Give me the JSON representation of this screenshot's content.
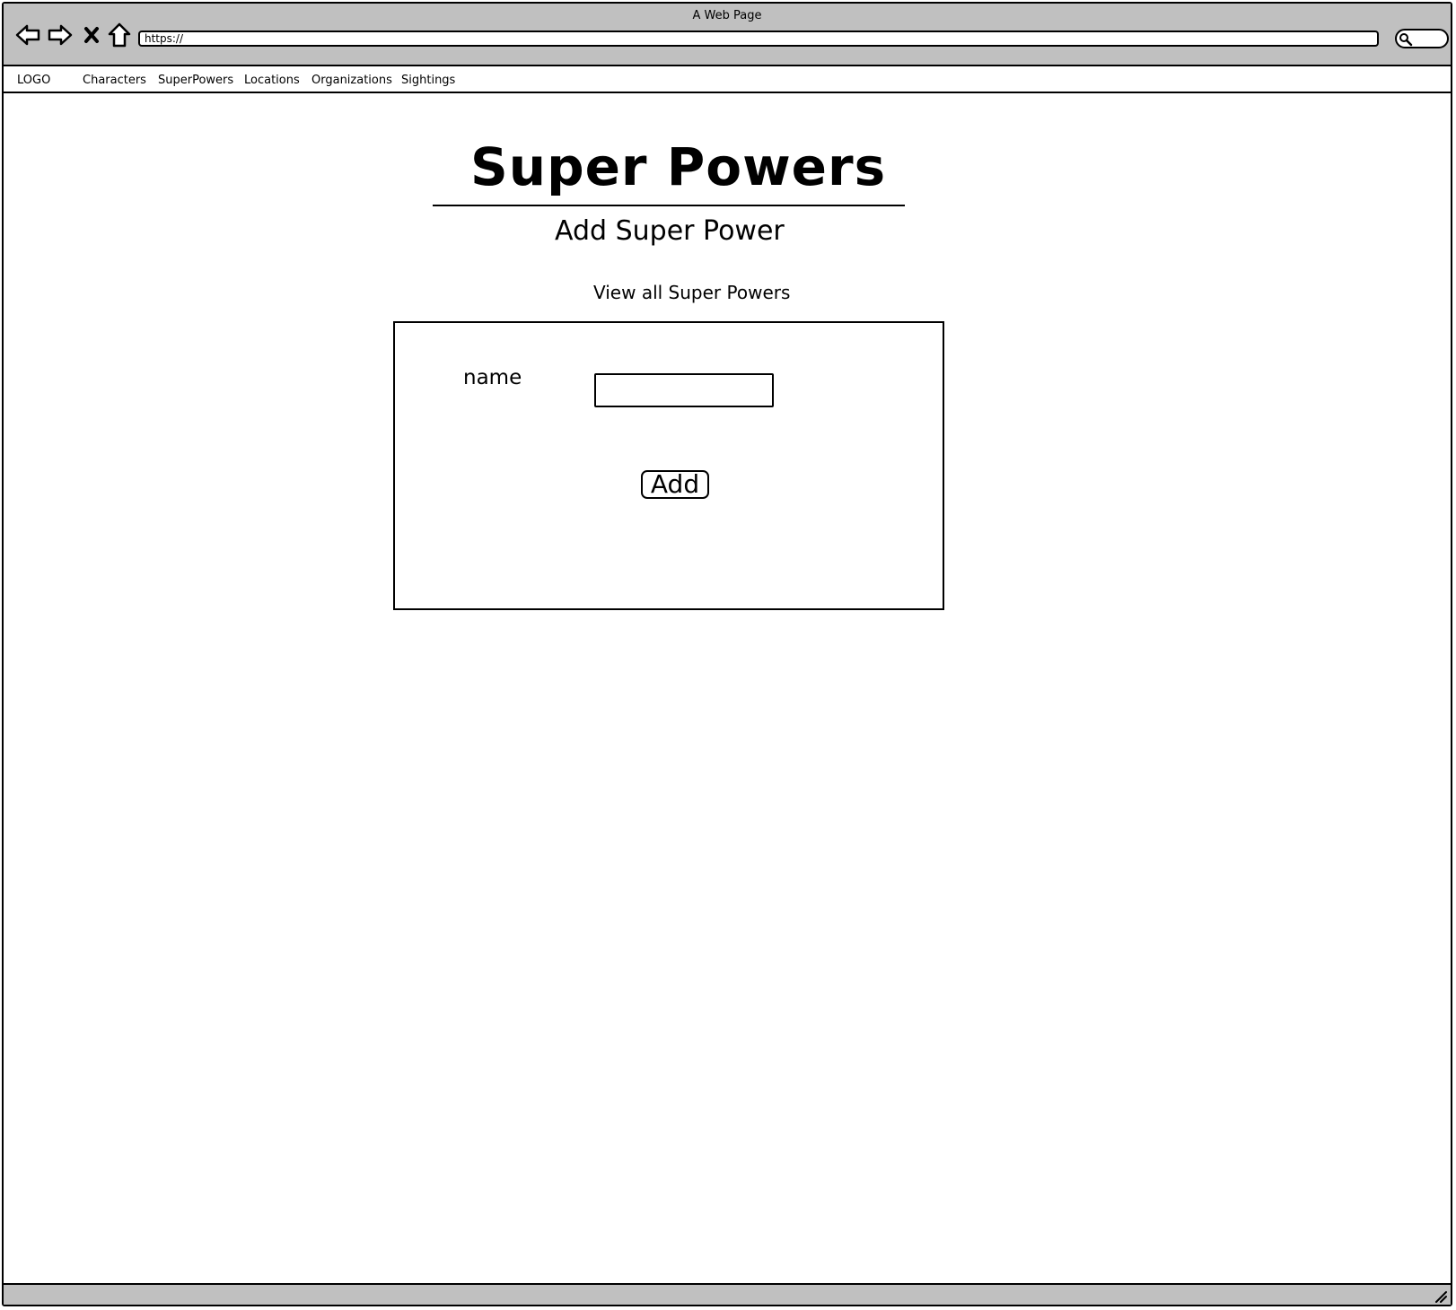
{
  "window": {
    "title": "A Web Page"
  },
  "toolbar": {
    "url": "https://",
    "back_icon": "back-arrow-icon",
    "forward_icon": "forward-arrow-icon",
    "stop_icon": "close-icon",
    "home_icon": "home-icon",
    "search_icon": "search-icon"
  },
  "nav": {
    "logo": "LOGO",
    "items": [
      {
        "label": "Characters"
      },
      {
        "label": "SuperPowers"
      },
      {
        "label": "Locations"
      },
      {
        "label": "Organizations"
      },
      {
        "label": "Sightings"
      }
    ]
  },
  "main": {
    "title": "Super Powers",
    "subtitle": "Add Super Power",
    "view_all_link": "View all Super Powers",
    "form": {
      "name_label": "name",
      "name_value": "",
      "submit_label": "Add"
    }
  },
  "colors": {
    "chrome": "#c0c0c0",
    "stroke": "#000000",
    "background": "#ffffff"
  }
}
